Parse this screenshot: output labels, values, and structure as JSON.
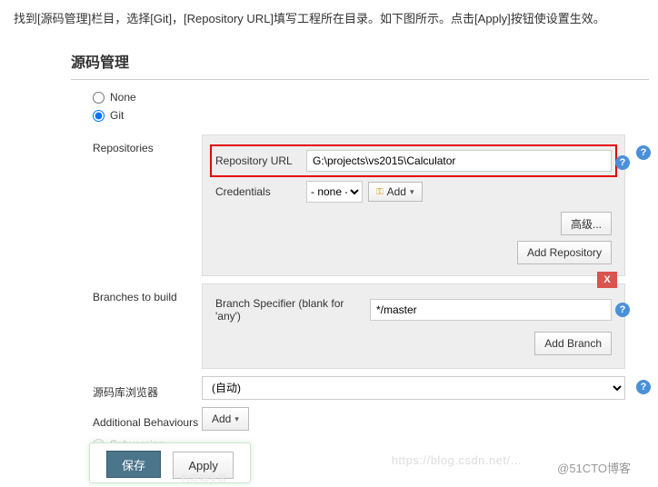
{
  "instruction": "找到[源码管理]栏目，选择[Git]，[Repository URL]填写工程所在目录。如下图所示。点击[Apply]按钮使设置生效。",
  "section_title": "源码管理",
  "scm": {
    "none_label": "None",
    "git_label": "Git",
    "subversion_label": "Subversion"
  },
  "repositories": {
    "label": "Repositories",
    "url_label": "Repository URL",
    "url_value": "G:\\projects\\vs2015\\Calculator",
    "credentials_label": "Credentials",
    "credentials_value": "- none -",
    "add_button": "Add",
    "advanced_button": "高级...",
    "add_repo_button": "Add Repository"
  },
  "branches": {
    "label": "Branches to build",
    "specifier_label": "Branch Specifier (blank for 'any')",
    "specifier_value": "*/master",
    "add_branch_button": "Add Branch",
    "delete_label": "X"
  },
  "browser": {
    "label": "源码库浏览器",
    "value": "(自动)"
  },
  "behaviours": {
    "label": "Additional Behaviours",
    "add_button": "Add"
  },
  "actions": {
    "save": "保存",
    "apply": "Apply"
  },
  "watermark": "@51CTO博客",
  "help": "?"
}
